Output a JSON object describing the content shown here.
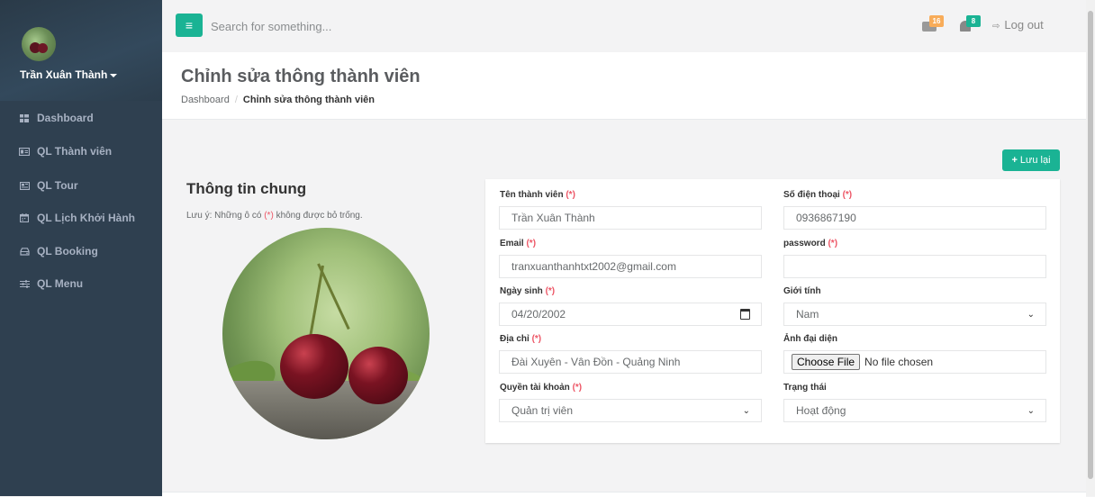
{
  "sidebar": {
    "username": "Trần Xuân Thành",
    "items": [
      {
        "label": "Dashboard",
        "icon": "grid-icon"
      },
      {
        "label": "QL Thành viên",
        "icon": "id-card-icon"
      },
      {
        "label": "QL Tour",
        "icon": "newspaper-icon"
      },
      {
        "label": "QL Lịch Khởi Hành",
        "icon": "calendar-icon"
      },
      {
        "label": "QL Booking",
        "icon": "hdd-icon"
      },
      {
        "label": "QL Menu",
        "icon": "sliders-icon"
      }
    ]
  },
  "topbar": {
    "menu_icon": "≡",
    "search_placeholder": "Search for something...",
    "messages_count": "16",
    "alerts_count": "8",
    "logout_label": "Log out"
  },
  "page": {
    "title": "Chỉnh sửa thông thành viên",
    "breadcrumb_home": "Dashboard",
    "breadcrumb_sep": "/",
    "breadcrumb_current": "Chỉnh sửa thông thành viên",
    "save_label": "Lưu lại"
  },
  "info": {
    "title": "Thông tin chung",
    "note_before": "Lưu ý: Những ô có",
    "note_req": "(*)",
    "note_after": "không được bỏ trống."
  },
  "form": {
    "req": "(*)",
    "name_label": "Tên thành viên",
    "name_value": "Trần Xuân Thành",
    "phone_label": "Số điện thoại",
    "phone_value": "0936867190",
    "email_label": "Email",
    "email_value": "tranxuanthanhtxt2002@gmail.com",
    "password_label": "password",
    "password_value": "",
    "dob_label": "Ngày sinh",
    "dob_value": "04/20/2002",
    "gender_label": "Giới tính",
    "gender_value": "Nam",
    "address_label": "Địa chỉ",
    "address_value": "Đài Xuyên - Vân Đồn - Quảng Ninh",
    "avatar_label": "Ảnh đại diện",
    "choose_file": "Choose File",
    "no_file": "No file chosen",
    "role_label": "Quyền tài khoản",
    "role_value": "Quản trị viên",
    "status_label": "Trạng thái",
    "status_value": "Hoạt động"
  },
  "colors": {
    "sidebar": "#2f4050",
    "primary": "#1ab394",
    "required": "#ed5565",
    "warning": "#f8ac59"
  }
}
